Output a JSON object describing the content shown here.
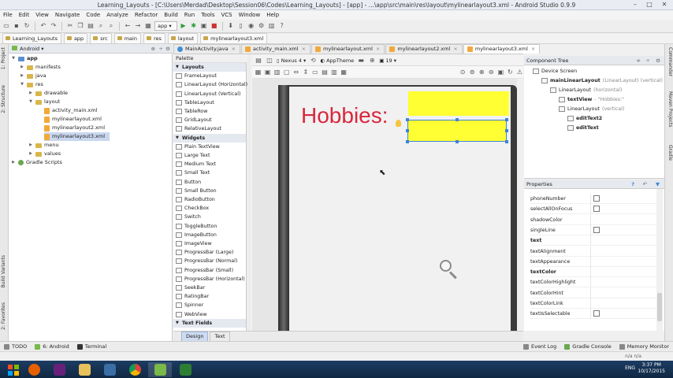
{
  "window": {
    "title": "Learning_Layouts - [C:\\Users\\Merdad\\Desktop\\Session06\\Codes\\Learning_Layouts] - [app] - ...\\app\\src\\main\\res\\layout\\mylinearlayout3.xml - Android Studio 0.9.9"
  },
  "menu": [
    "File",
    "Edit",
    "View",
    "Navigate",
    "Code",
    "Analyze",
    "Refactor",
    "Build",
    "Run",
    "Tools",
    "VCS",
    "Window",
    "Help"
  ],
  "toolbar": {
    "run_config": "app"
  },
  "breadcrumb": [
    "Learning_Layouts",
    "app",
    "src",
    "main",
    "res",
    "layout",
    "mylinearlayout3.xml"
  ],
  "left_tabs": [
    "1: Project",
    "2: Structure",
    "Build Variants",
    "2: Favorites"
  ],
  "right_tabs": [
    "Commander",
    "Maven Projects",
    "Gradle"
  ],
  "project": {
    "view": "Android",
    "tree": [
      {
        "label": "app",
        "level": 0
      },
      {
        "label": "manifests",
        "level": 1
      },
      {
        "label": "java",
        "level": 1
      },
      {
        "label": "res",
        "level": 1
      },
      {
        "label": "drawable",
        "level": 2
      },
      {
        "label": "layout",
        "level": 2
      },
      {
        "label": "activity_main.xml",
        "level": 3
      },
      {
        "label": "mylinearlayout.xml",
        "level": 3
      },
      {
        "label": "mylinearlayout2.xml",
        "level": 3
      },
      {
        "label": "mylinearlayout3.xml",
        "level": 3
      },
      {
        "label": "menu",
        "level": 2
      },
      {
        "label": "values",
        "level": 2
      },
      {
        "label": "Gradle Scripts",
        "level": 0
      }
    ]
  },
  "editor_tabs": [
    {
      "label": "MainActivity.java",
      "type": "java",
      "active": false
    },
    {
      "label": "activity_main.xml",
      "type": "xml",
      "active": false
    },
    {
      "label": "mylinearlayout.xml",
      "type": "xml",
      "active": false
    },
    {
      "label": "mylinearlayout2.xml",
      "type": "xml",
      "active": false
    },
    {
      "label": "mylinearlayout3.xml",
      "type": "xml",
      "active": true
    }
  ],
  "palette": {
    "title": "Palette",
    "items": [
      {
        "label": "Layouts",
        "cat": true
      },
      {
        "label": "FrameLayout"
      },
      {
        "label": "LinearLayout (Horizontal)"
      },
      {
        "label": "LinearLayout (Vertical)"
      },
      {
        "label": "TableLayout"
      },
      {
        "label": "TableRow"
      },
      {
        "label": "GridLayout"
      },
      {
        "label": "RelativeLayout"
      },
      {
        "label": "Widgets",
        "cat": true
      },
      {
        "label": "Plain TextView"
      },
      {
        "label": "Large Text"
      },
      {
        "label": "Medium Text"
      },
      {
        "label": "Small Text"
      },
      {
        "label": "Button"
      },
      {
        "label": "Small Button"
      },
      {
        "label": "RadioButton"
      },
      {
        "label": "CheckBox"
      },
      {
        "label": "Switch"
      },
      {
        "label": "ToggleButton"
      },
      {
        "label": "ImageButton"
      },
      {
        "label": "ImageView"
      },
      {
        "label": "ProgressBar (Large)"
      },
      {
        "label": "ProgressBar (Normal)"
      },
      {
        "label": "ProgressBar (Small)"
      },
      {
        "label": "ProgressBar (Horizontal)"
      },
      {
        "label": "SeekBar"
      },
      {
        "label": "RatingBar"
      },
      {
        "label": "Spinner"
      },
      {
        "label": "WebView"
      },
      {
        "label": "Text Fields",
        "cat": true
      }
    ]
  },
  "designer": {
    "device": "Nexus 4",
    "theme": "AppTheme",
    "api": "19",
    "textview_text": "Hobbies:",
    "colors": {
      "edit_bg": "#ffff33",
      "text": "#d8283e",
      "selection": "#3c84d8"
    }
  },
  "design_tabs": [
    "Design",
    "Text"
  ],
  "component_tree": {
    "title": "Component Tree",
    "nodes": [
      {
        "label": "Device Screen",
        "hint": "",
        "level": 0,
        "bold": false
      },
      {
        "label": "mainLinearLayout",
        "hint": "(LinearLayout) (vertical)",
        "level": 1,
        "bold": true
      },
      {
        "label": "LinearLayout",
        "hint": "(horizontal)",
        "level": 2,
        "bold": false
      },
      {
        "label": "textView",
        "hint": "- \"Hobbies:\"",
        "level": 3,
        "bold": true
      },
      {
        "label": "LinearLayout",
        "hint": "(vertical)",
        "level": 3,
        "bold": false
      },
      {
        "label": "editText2",
        "hint": "",
        "level": 4,
        "bold": true
      },
      {
        "label": "editText",
        "hint": "",
        "level": 4,
        "bold": true
      }
    ]
  },
  "properties": {
    "title": "Properties",
    "rows": [
      {
        "name": "phoneNumber",
        "checkbox": true,
        "bold": false
      },
      {
        "name": "selectAllOnFocus",
        "checkbox": true,
        "bold": false
      },
      {
        "name": "shadowColor",
        "checkbox": false,
        "bold": false
      },
      {
        "name": "singleLine",
        "checkbox": true,
        "bold": false
      },
      {
        "name": "text",
        "checkbox": false,
        "bold": true
      },
      {
        "name": "textAlignment",
        "checkbox": false,
        "bold": false
      },
      {
        "name": "textAppearance",
        "checkbox": false,
        "bold": false
      },
      {
        "name": "textColor",
        "checkbox": false,
        "bold": true
      },
      {
        "name": "textColorHighlight",
        "checkbox": false,
        "bold": false
      },
      {
        "name": "textColorHint",
        "checkbox": false,
        "bold": false
      },
      {
        "name": "textColorLink",
        "checkbox": false,
        "bold": false
      },
      {
        "name": "textIsSelectable",
        "checkbox": true,
        "bold": false
      }
    ]
  },
  "bottom_tools": {
    "left": [
      "TODO",
      "6: Android",
      "Terminal"
    ],
    "right": [
      "Event Log",
      "Gradle Console",
      "Memory Monitor"
    ]
  },
  "status": {
    "right": "n/a    n/a"
  },
  "taskbar": {
    "lang": "ENG",
    "time": "3:37 PM",
    "date": "10/17/2015"
  }
}
